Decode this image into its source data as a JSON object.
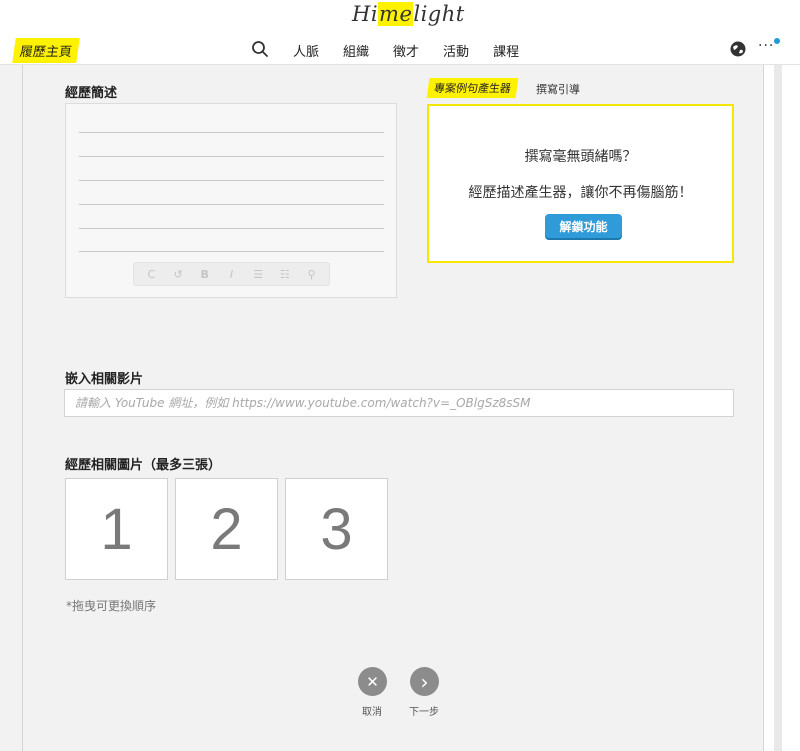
{
  "header": {
    "logo_text_pre": "Hi",
    "logo_text_hl": "me",
    "logo_text_post": "light",
    "home_label": "履歷主頁",
    "nav": [
      "人脈",
      "組織",
      "徵才",
      "活動",
      "課程"
    ],
    "more_label": "···",
    "icons": {
      "search": "search-icon",
      "globe": "globe-icon"
    },
    "accent_color": "#fff200",
    "notify_dot_color": "#1d9bd6"
  },
  "summary": {
    "title": "經歷簡述",
    "toolbar": [
      "C",
      "↺",
      "B",
      "I",
      "☰",
      "☷",
      "⚲"
    ]
  },
  "generator": {
    "tab_active": "專案例句產生器",
    "tab_other": "撰寫引導",
    "line1": "撰寫毫無頭緒嗎？",
    "line2": "經歷描述產生器，讓你不再傷腦筋！",
    "unlock_label": "解鎖功能",
    "button_color": "#2f9bd9"
  },
  "video": {
    "title": "嵌入相關影片",
    "placeholder": "請輸入 YouTube 網址，例如 https://www.youtube.com/watch?v=_OBlgSz8sSM"
  },
  "photos": {
    "title": "經歷相關圖片（最多三張）",
    "slots": [
      "1",
      "2",
      "3"
    ],
    "hint": "*拖曳可更換順序"
  },
  "actions": {
    "cancel_label": "取消",
    "next_label": "下一步",
    "cancel_icon": "✕",
    "next_icon": "›"
  }
}
